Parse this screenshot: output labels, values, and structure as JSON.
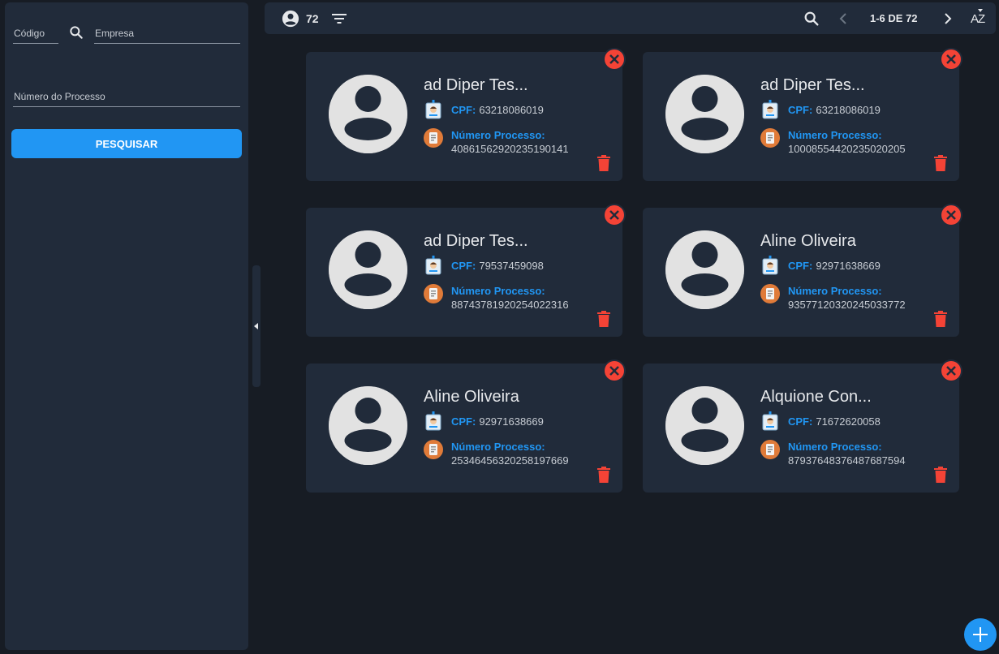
{
  "sidebar": {
    "codigo_label": "Código",
    "empresa_label": "Empresa",
    "processo_label": "Número do Processo",
    "search_button": "PESQUISAR"
  },
  "topbar": {
    "count": "72",
    "pagination": "1-6 DE 72",
    "sort_label": "AZ"
  },
  "labels": {
    "cpf": "CPF:",
    "processo": "Número Processo:"
  },
  "cards": [
    {
      "name": "ad Diper Tes...",
      "cpf": "63218086019",
      "processo": "40861562920235190141"
    },
    {
      "name": "ad Diper Tes...",
      "cpf": "63218086019",
      "processo": "10008554420235020205"
    },
    {
      "name": "ad Diper Tes...",
      "cpf": "79537459098",
      "processo": "88743781920254022316"
    },
    {
      "name": "Aline Oliveira",
      "cpf": "92971638669",
      "processo": "93577120320245033772"
    },
    {
      "name": "Aline Oliveira",
      "cpf": "92971638669",
      "processo": "25346456320258197669"
    },
    {
      "name": "Alquione Con...",
      "cpf": "71672620058",
      "processo": "87937648376487687594"
    }
  ],
  "colors": {
    "accent": "#2196f3",
    "danger": "#f44336",
    "card_bg": "#212b3a",
    "page_bg": "#171c24"
  }
}
